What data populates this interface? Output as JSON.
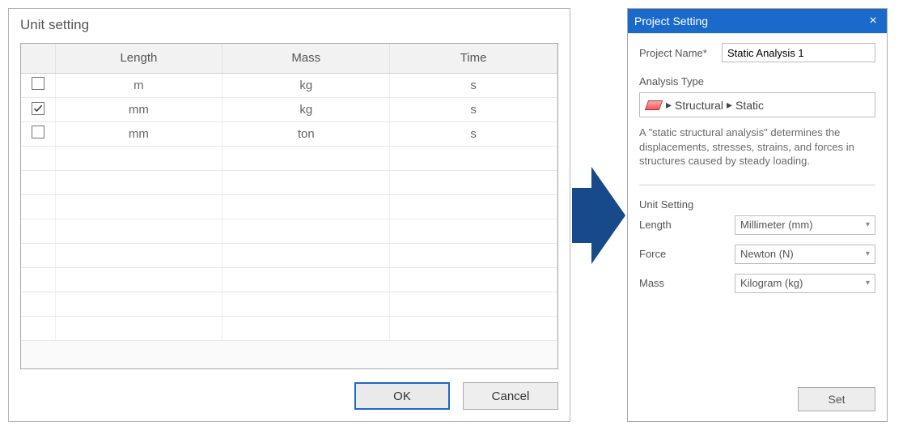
{
  "unit_dialog": {
    "title": "Unit setting",
    "headers": {
      "length": "Length",
      "mass": "Mass",
      "time": "Time"
    },
    "rows": [
      {
        "checked": false,
        "length": "m",
        "mass": "kg",
        "time": "s"
      },
      {
        "checked": true,
        "length": "mm",
        "mass": "kg",
        "time": "s"
      },
      {
        "checked": false,
        "length": "mm",
        "mass": "ton",
        "time": "s"
      }
    ],
    "buttons": {
      "ok": "OK",
      "cancel": "Cancel"
    }
  },
  "project_panel": {
    "title": "Project Setting",
    "close_glyph": "×",
    "name_label": "Project Name*",
    "name_value": "Static Analysis 1",
    "analysis_label": "Analysis Type",
    "breadcrumb": {
      "sep": "▸",
      "level1": "Structural",
      "level2": "Static"
    },
    "description": "A \"static structural analysis\" determines the displacements, stresses, strains, and forces in structures caused by steady loading.",
    "unit_section_label": "Unit Setting",
    "fields": {
      "length": {
        "label": "Length",
        "value": "Millimeter (mm)"
      },
      "force": {
        "label": "Force",
        "value": "Newton (N)"
      },
      "mass": {
        "label": "Mass",
        "value": "Kilogram (kg)"
      }
    },
    "set_button": "Set"
  }
}
